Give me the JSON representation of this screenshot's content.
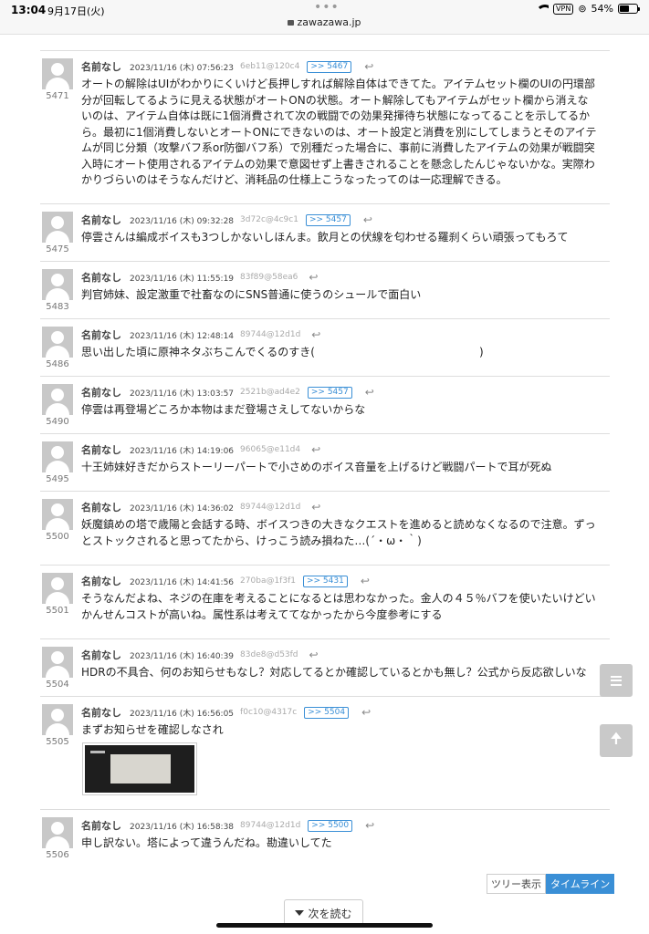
{
  "status_bar": {
    "time": "13:04",
    "date": "9月17日(火)",
    "url": "zawazawa.jp",
    "vpn": "VPN",
    "battery": "54%",
    "battery_level": 0.54
  },
  "posts": [
    {
      "number": "5471",
      "name": "名前なし",
      "date": "2023/11/16 (木) 07:56:23",
      "id": "6eb11@120c4",
      "anchor": ">> 5467",
      "lines": [
        "オートの解除はUIがわかりにくいけど長押しすれば解除自体はできてた。アイテムセット欄のUIの円環部",
        "分が回転してるように見える状態がオートONの状態。オート解除してもアイテムがセット欄から消えな",
        "いのは、アイテム自体は既に1個消費されて次の戦闘での効果発揮待ち状態になってることを示してるか",
        "ら。最初に1個消費しないとオートONにできないのは、オート設定と消費を別にしてしまうとそのアイテ",
        "ムが同じ分類（攻撃バフ系or防御バフ系）で別種だった場合に、事前に消費したアイテムの効果が戦闘突",
        "入時にオート使用されるアイテムの効果で意図せず上書きされることを懸念したんじゃないかな。実際わ",
        "かりづらいのはそうなんだけど、消耗品の仕様上こうなったってのは一応理解できる。"
      ]
    },
    {
      "number": "5475",
      "name": "名前なし",
      "date": "2023/11/16 (木) 09:32:28",
      "id": "3d72c@4c9c1",
      "anchor": ">> 5457",
      "lines": [
        "停雲さんは編成ボイスも3つしかないしほんま。飲月との伏線を匂わせる羅刹くらい頑張ってもろて"
      ]
    },
    {
      "number": "5483",
      "name": "名前なし",
      "date": "2023/11/16 (木) 11:55:19",
      "id": "83f89@58ea6",
      "anchor": "",
      "lines": [
        "判官姉妹、設定激重で社畜なのにSNS普通に使うのシュールで面白い"
      ]
    },
    {
      "number": "5486",
      "name": "名前なし",
      "date": "2023/11/16 (木) 12:48:14",
      "id": "89744@12d1d",
      "anchor": "",
      "lines": [
        "思い出した頃に原神ネタぶちこんでくるのすき(　　　　　　　　　　　　　　　)"
      ]
    },
    {
      "number": "5490",
      "name": "名前なし",
      "date": "2023/11/16 (木) 13:03:57",
      "id": "2521b@ad4e2",
      "anchor": ">> 5457",
      "lines": [
        "停雲は再登場どころか本物はまだ登場さえしてないからな"
      ]
    },
    {
      "number": "5495",
      "name": "名前なし",
      "date": "2023/11/16 (木) 14:19:06",
      "id": "96065@e11d4",
      "anchor": "",
      "lines": [
        "十王姉妹好きだからストーリーパートで小さめのボイス音量を上げるけど戦闘パートで耳が死ぬ"
      ]
    },
    {
      "number": "5500",
      "name": "名前なし",
      "date": "2023/11/16 (木) 14:36:02",
      "id": "89744@12d1d",
      "anchor": "",
      "lines": [
        "妖魔鎮めの塔で歳陽と会話する時、ボイスつきの大きなクエストを進めると読めなくなるので注意。ずっ",
        "とストックされると思ってたから、けっこう読み損ねた…(´・ω・｀)"
      ]
    },
    {
      "number": "5501",
      "name": "名前なし",
      "date": "2023/11/16 (木) 14:41:56",
      "id": "270ba@1f3f1",
      "anchor": ">> 5431",
      "lines": [
        "そうなんだよね、ネジの在庫を考えることになるとは思わなかった。金人の４５％バフを使いたいけどい",
        "かんせんコストが高いね。属性系は考えててなかったから今度参考にする"
      ]
    },
    {
      "number": "5504",
      "name": "名前なし",
      "date": "2023/11/16 (木) 16:40:39",
      "id": "83de8@d53fd",
      "anchor": "",
      "lines": [
        "HDRの不具合、何のお知らせもなし？対応してるとか確認しているとかも無し？公式から反応欲しいな"
      ]
    },
    {
      "number": "5505",
      "name": "名前なし",
      "date": "2023/11/16 (木) 16:56:05",
      "id": "f0c10@4317c",
      "anchor": ">> 5504",
      "lines": [
        "まずお知らせを確認しなされ"
      ]
    },
    {
      "number": "5506",
      "name": "名前なし",
      "date": "2023/11/16 (木) 16:58:38",
      "id": "89744@12d1d",
      "anchor": ">> 5500",
      "lines": [
        "申し訳ない。塔によって違うんだね。勘違いしてた"
      ]
    }
  ],
  "view_toggle": {
    "tree": "ツリー表示",
    "timeline": "タイムライン"
  },
  "next_button": "次を読む",
  "icons": {
    "reply": "reply-arrow-icon",
    "menu": "menu-lines-icon",
    "scroll_top": "arrow-up-icon",
    "next": "triangle-down-icon"
  },
  "colors": {
    "accent": "#3a8fd6",
    "side_button": "#c9c9c9"
  }
}
